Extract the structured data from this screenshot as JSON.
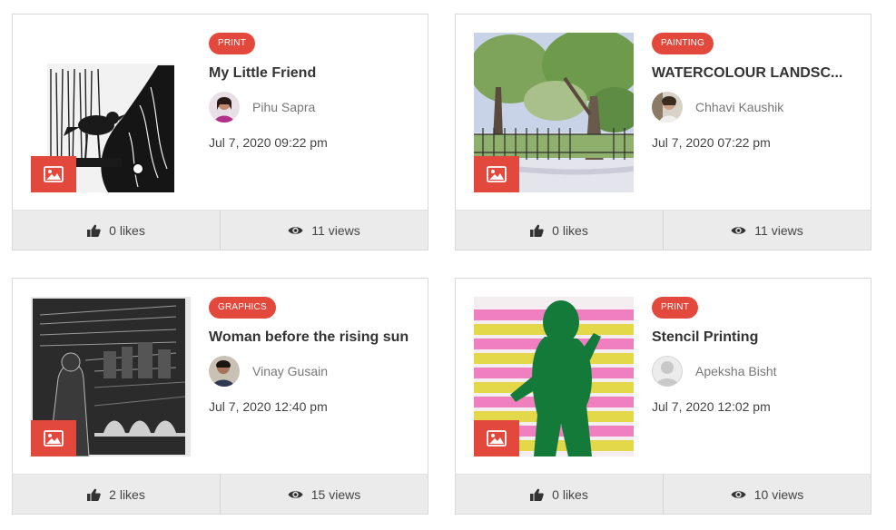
{
  "colors": {
    "accent": "#e3483c",
    "footer_bg": "#ebebeb",
    "border": "#d9d9d9"
  },
  "posts": [
    {
      "category": "PRINT",
      "title": "My Little Friend",
      "author": "Pihu Sapra",
      "date": "Jul 7, 2020 09:22 pm",
      "likes": "0",
      "likes_label": "likes",
      "views": "11",
      "views_label": "views",
      "thumbnail": "woodcut-bird-artwork",
      "avatar": "girl-portrait-avatar"
    },
    {
      "category": "PAINTING",
      "title": "WATERCOLOUR LANDSC...",
      "author": "Chhavi Kaushik",
      "date": "Jul 7, 2020 07:22 pm",
      "likes": "0",
      "likes_label": "likes",
      "views": "11",
      "views_label": "views",
      "thumbnail": "watercolour-trees-artwork",
      "avatar": "person-portrait-avatar"
    },
    {
      "category": "GRAPHICS",
      "title": "Woman before the rising sun",
      "author": "Vinay Gusain",
      "date": "Jul 7, 2020 12:40 pm",
      "likes": "2",
      "likes_label": "likes",
      "views": "15",
      "views_label": "views",
      "thumbnail": "linocut-city-artwork",
      "avatar": "man-portrait-avatar"
    },
    {
      "category": "PRINT",
      "title": "Stencil Printing",
      "author": "Apeksha Bisht",
      "date": "Jul 7, 2020 12:02 pm",
      "likes": "0",
      "likes_label": "likes",
      "views": "10",
      "views_label": "views",
      "thumbnail": "stencil-child-artwork",
      "avatar": "default-user-avatar"
    }
  ]
}
